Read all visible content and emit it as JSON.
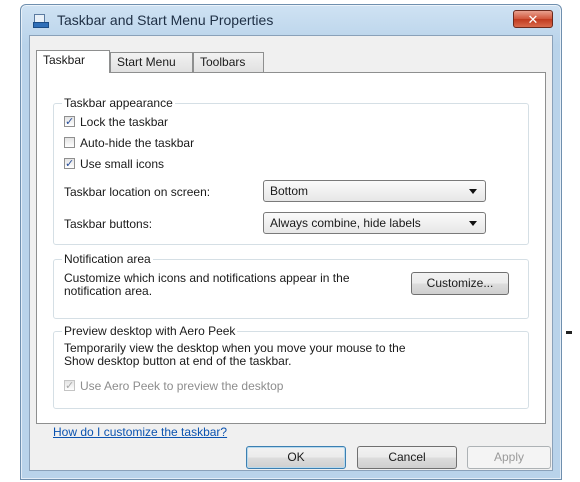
{
  "window": {
    "title": "Taskbar and Start Menu Properties",
    "close_glyph": "✕"
  },
  "tabs": [
    {
      "label": "Taskbar",
      "active": true
    },
    {
      "label": "Start Menu",
      "active": false
    },
    {
      "label": "Toolbars",
      "active": false
    }
  ],
  "taskbar_appearance": {
    "label": "Taskbar appearance",
    "lock": {
      "label": "Lock the taskbar",
      "checked": true
    },
    "autohide": {
      "label": "Auto-hide the taskbar",
      "checked": false
    },
    "small_icons": {
      "label": "Use small icons",
      "checked": true
    },
    "location_label": "Taskbar location on screen:",
    "location_value": "Bottom",
    "buttons_label": "Taskbar buttons:",
    "buttons_value": "Always combine, hide labels"
  },
  "notification_area": {
    "label": "Notification area",
    "description_line1": "Customize which icons and notifications appear in the",
    "description_line2": "notification area.",
    "customize_button": "Customize..."
  },
  "aero_peek": {
    "label": "Preview desktop with Aero Peek",
    "description_line1": "Temporarily view the desktop when you move your mouse to the",
    "description_line2": "Show desktop button at end of the taskbar.",
    "checkbox_label": "Use Aero Peek to preview the desktop",
    "checked": true,
    "enabled": false
  },
  "help_link": "How do I customize the taskbar?",
  "buttons": {
    "ok": "OK",
    "cancel": "Cancel",
    "apply": "Apply"
  },
  "icons": {
    "title": "taskbar-window-icon",
    "close": "close-icon",
    "dropdown": "chevron-down-icon",
    "check": "checkmark-icon"
  },
  "colors": {
    "title_bar": "#b9d3ea",
    "close_button": "#c03a1f",
    "link": "#0b53b0",
    "panel": "#ffffff"
  }
}
